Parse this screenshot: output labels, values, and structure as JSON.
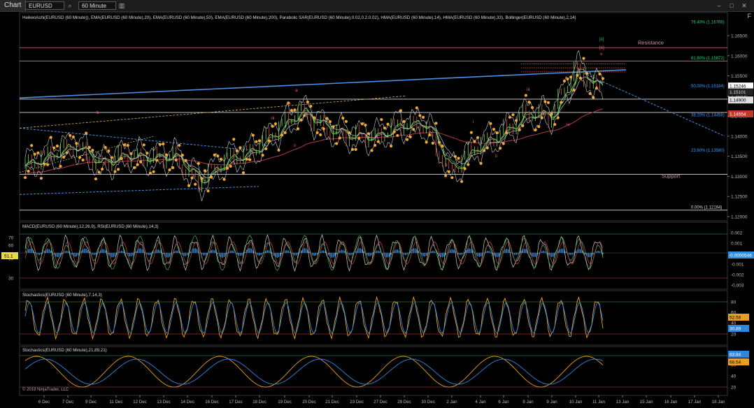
{
  "toolbar": {
    "chart_tab": "Chart",
    "instrument": "EURUSD",
    "interval": "60 Minute"
  },
  "top_right_label": "F",
  "copyright": "© 2019 NinjaTrader, LLC",
  "panels": {
    "price": {
      "indicator_label": "HeikenAshi(EURUSD (60 Minute)), EMA(EURUSD (60 Minute),20), EMA(EURUSD (60 Minute),50), EMA(EURUSD (60 Minute),200), Parabolic SAR(EURUSD (60 Minute),0.02,0.2,0.02), HMA(EURUSD (60 Minute),14), HMA(EURUSD (60 Minute),33), Bollinger(EURUSD (60 Minute),2,14)",
      "y_ticks": [
        "1.16500",
        "1.16000",
        "1.15500",
        "1.15000",
        "1.14500",
        "1.14000",
        "1.13500",
        "1.13000",
        "1.12500",
        "1.12000"
      ],
      "price_markers": [
        {
          "label": "1.15246",
          "bg": "#ffffff",
          "fg": "#000000"
        },
        {
          "label": "1.15101",
          "bg": "#222222",
          "fg": "#dddddd"
        },
        {
          "label": "1.14900",
          "bg": "#dddddd",
          "fg": "#000000"
        },
        {
          "label": "1.14554",
          "bg": "#c0392b",
          "fg": "#ffffff"
        }
      ],
      "fib_levels": [
        {
          "label": "76.40% (1.16766)",
          "color": "#2ecc71"
        },
        {
          "label": "61.80% (1.15872)",
          "color": "#2ecc71"
        },
        {
          "label": "50.00% (1.15184)",
          "color": "#3aa0ff"
        },
        {
          "label": "38.20% (1.14458)",
          "color": "#3aa0ff"
        },
        {
          "label": "23.60% (1.13580)",
          "color": "#3aa0ff"
        },
        {
          "label": "0.00% (1.12164)",
          "color": "#dddddd"
        }
      ],
      "resistance_label": "Resistance",
      "support_label": "Support",
      "wave_labels": [
        "[ii]",
        "[c]",
        "v",
        "b",
        "a",
        "iii",
        "b",
        "c",
        "i",
        "ii",
        "iii",
        "iv",
        "i",
        "ii",
        "b"
      ]
    },
    "macd": {
      "indicator_label": "MACD(EURUSD (60 Minute),12,26,9), RSI(EURUSD (60 Minute),14,3)",
      "right_ticks": [
        "0.002",
        "0.001",
        "-0.001",
        "-0.002",
        "-0.003"
      ],
      "left_ticks": [
        "70",
        "60",
        "50",
        "30"
      ],
      "value_marker": "-0.0000546",
      "left_marker": "51.1"
    },
    "stoch1": {
      "indicator_label": "Stochastics(EURUSD (60 Minute),7,14,3)",
      "right_ticks": [
        "80",
        "60",
        "40",
        "20"
      ],
      "markers": [
        "52.56",
        "30.89"
      ]
    },
    "stoch2": {
      "indicator_label": "Stochastics(EURUSD (60 Minute),21,89,21)",
      "right_ticks": [
        "60",
        "40",
        "20"
      ],
      "markers": [
        "83.84",
        "68.54"
      ]
    }
  },
  "x_axis": [
    "6 Dec",
    "7 Dec",
    "9 Dec",
    "11 Dec",
    "12 Dec",
    "13 Dec",
    "14 Dec",
    "16 Dec",
    "17 Dec",
    "18 Dec",
    "19 Dec",
    "20 Dec",
    "21 Dec",
    "23 Dec",
    "27 Dec",
    "28 Dec",
    "30 Dec",
    "2 Jan",
    "4 Jan",
    "6 Jan",
    "8 Jan",
    "9 Jan",
    "10 Jan",
    "11 Jan",
    "13 Jan",
    "15 Jan",
    "16 Jan",
    "17 Jan",
    "18 Jan"
  ],
  "chart_data": {
    "type": "line",
    "x": [
      "6 Dec",
      "7 Dec",
      "9 Dec",
      "11 Dec",
      "12 Dec",
      "13 Dec",
      "14 Dec",
      "16 Dec",
      "17 Dec",
      "18 Dec",
      "19 Dec",
      "20 Dec",
      "21 Dec",
      "23 Dec",
      "27 Dec",
      "28 Dec",
      "30 Dec",
      "2 Jan",
      "4 Jan",
      "6 Jan",
      "8 Jan",
      "9 Jan",
      "10 Jan",
      "11 Jan"
    ],
    "series": [
      {
        "values": [
          1.1325,
          1.1352,
          1.1378,
          1.133,
          1.1352,
          1.1345,
          1.135,
          1.1285,
          1.134,
          1.136,
          1.141,
          1.1465,
          1.1418,
          1.14,
          1.1398,
          1.1428,
          1.143,
          1.131,
          1.1375,
          1.1405,
          1.1458,
          1.145,
          1.1568,
          1.1512
        ]
      }
    ],
    "ylim": [
      1.12,
      1.169
    ],
    "grid": false
  },
  "colors": {
    "background": "#000000",
    "sar": "#f0a830",
    "ema": "#66d06a",
    "bollinger": "#cfcfcf",
    "trend_blue": "#4a90e2",
    "ema200": "#b03a4a",
    "macd_hist": "#2e8fe0",
    "stoch_k": "#e8a020",
    "stoch_d": "#2f86e0"
  }
}
